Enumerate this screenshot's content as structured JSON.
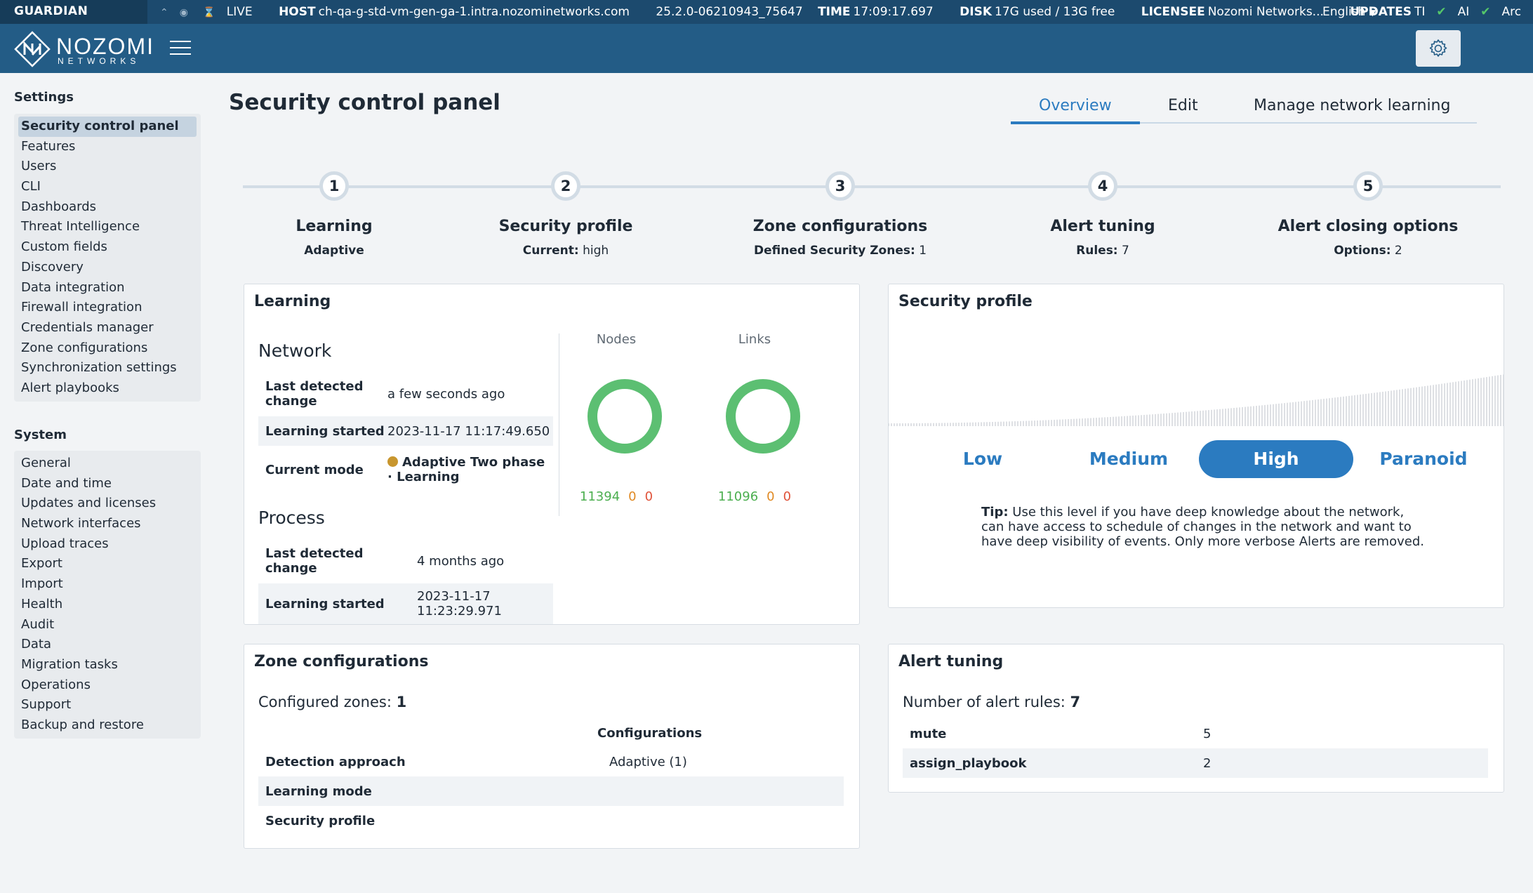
{
  "statusbar": {
    "product": "GUARDIAN",
    "live": "LIVE",
    "host_label": "HOST",
    "host_value": "ch-qa-g-std-vm-gen-ga-1.intra.nozominetworks.com",
    "version": "25.2.0-06210943_75647",
    "time_label": "TIME",
    "time_value": "17:09:17.697",
    "disk_label": "DISK",
    "disk_value": "17G used / 13G free",
    "licensee_label": "LICENSEE",
    "licensee_value": "Nozomi Networks...",
    "updates_label": "UPDATES",
    "updates_ti": "TI",
    "updates_ai": "AI",
    "updates_arc": "Arc",
    "language": "English"
  },
  "logo": {
    "word": "NOZOMI",
    "sub": "NETWORKS"
  },
  "sidebar": {
    "settings_heading": "Settings",
    "settings_items": [
      "Security control panel",
      "Features",
      "Users",
      "CLI",
      "Dashboards",
      "Threat Intelligence",
      "Custom fields",
      "Discovery",
      "Data integration",
      "Firewall integration",
      "Credentials manager",
      "Zone configurations",
      "Synchronization settings",
      "Alert playbooks"
    ],
    "system_heading": "System",
    "system_items": [
      "General",
      "Date and time",
      "Updates and licenses",
      "Network interfaces",
      "Upload traces",
      "Export",
      "Import",
      "Health",
      "Audit",
      "Data",
      "Migration tasks",
      "Operations",
      "Support",
      "Backup and restore"
    ]
  },
  "page": {
    "title": "Security control panel"
  },
  "tabs": [
    "Overview",
    "Edit",
    "Manage network learning"
  ],
  "steps": [
    {
      "num": "1",
      "name": "Learning",
      "sub_label": "Adaptive",
      "sub_value": ""
    },
    {
      "num": "2",
      "name": "Security profile",
      "sub_label": "Current:",
      "sub_value": "high"
    },
    {
      "num": "3",
      "name": "Zone configurations",
      "sub_label": "Defined Security Zones:",
      "sub_value": "1"
    },
    {
      "num": "4",
      "name": "Alert tuning",
      "sub_label": "Rules:",
      "sub_value": "7"
    },
    {
      "num": "5",
      "name": "Alert closing options",
      "sub_label": "Options:",
      "sub_value": "2"
    }
  ],
  "learning": {
    "title": "Learning",
    "network_title": "Network",
    "network_rows": [
      {
        "label": "Last detected change",
        "value": "a few seconds ago"
      },
      {
        "label": "Learning started",
        "value": "2023-11-17 11:17:49.650"
      },
      {
        "label": "Current mode",
        "value": "Adaptive Two phase · Learning"
      }
    ],
    "process_title": "Process",
    "process_rows": [
      {
        "label": "Last detected change",
        "value": "4 months ago"
      },
      {
        "label": "Learning started",
        "value": "2023-11-17 11:23:29.971"
      }
    ],
    "nodes": {
      "label": "Nodes",
      "learned": "11394",
      "pending": "0",
      "unlearned": "0"
    },
    "links": {
      "label": "Links",
      "learned": "11096",
      "pending": "0",
      "unlearned": "0"
    },
    "colors": {
      "learned": "#5cbf72",
      "pending": "#e08a24",
      "unlearned": "#e0533a",
      "mode_dot": "#c8962e"
    }
  },
  "security_profile": {
    "title": "Security profile",
    "levels": [
      "Low",
      "Medium",
      "High",
      "Paranoid"
    ],
    "selected": "High",
    "tip_label": "Tip:",
    "tip_text": "Use this level if you have deep knowledge about the network, can have access to schedule of changes in the network and want to have deep visibility of events. Only more verbose Alerts are removed."
  },
  "zone_config": {
    "title": "Zone configurations",
    "configured_label": "Configured zones:",
    "configured_value": "1",
    "col_header": "Configurations",
    "rows": [
      {
        "label": "Detection approach",
        "value": "Adaptive (1)"
      },
      {
        "label": "Learning mode",
        "value": ""
      },
      {
        "label": "Security profile",
        "value": ""
      }
    ]
  },
  "alert_tuning": {
    "title": "Alert tuning",
    "count_label": "Number of alert rules:",
    "count_value": "7",
    "rows": [
      {
        "label": "mute",
        "value": "5"
      },
      {
        "label": "assign_playbook",
        "value": "2"
      }
    ]
  }
}
